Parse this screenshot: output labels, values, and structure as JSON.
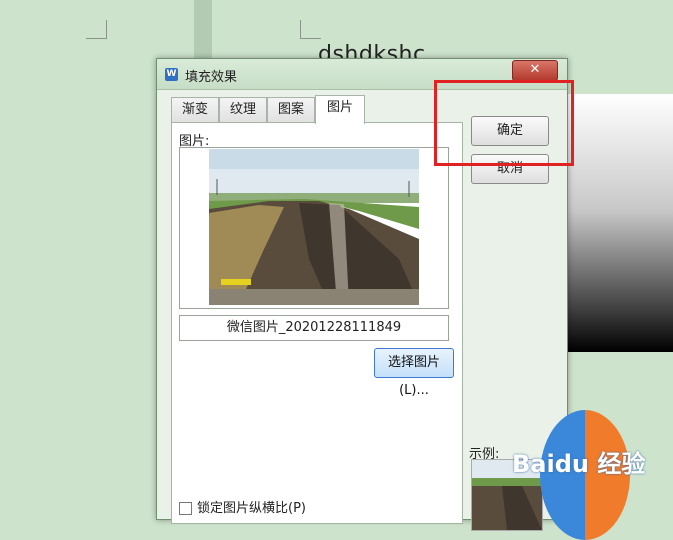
{
  "document": {
    "heading": "dshdkshc"
  },
  "dialog": {
    "title": "填充效果",
    "close_label": "✕",
    "tabs": [
      {
        "label": "渐变",
        "active": false
      },
      {
        "label": "纹理",
        "active": false
      },
      {
        "label": "图案",
        "active": false
      },
      {
        "label": "图片",
        "active": true
      }
    ],
    "picture_label": "图片:",
    "filename": "微信图片_20201228111849",
    "choose_button": "选择图片(L)...",
    "lock_ratio_label": "锁定图片纵横比(P)",
    "ok_button": "确定",
    "cancel_button": "取消",
    "sample_label": "示例:"
  },
  "watermark": {
    "text": "Baidu 经验"
  },
  "colors": {
    "page_bg": "#cde3cc",
    "highlight": "#e02222",
    "choose_button_border": "#3d7bd1"
  }
}
